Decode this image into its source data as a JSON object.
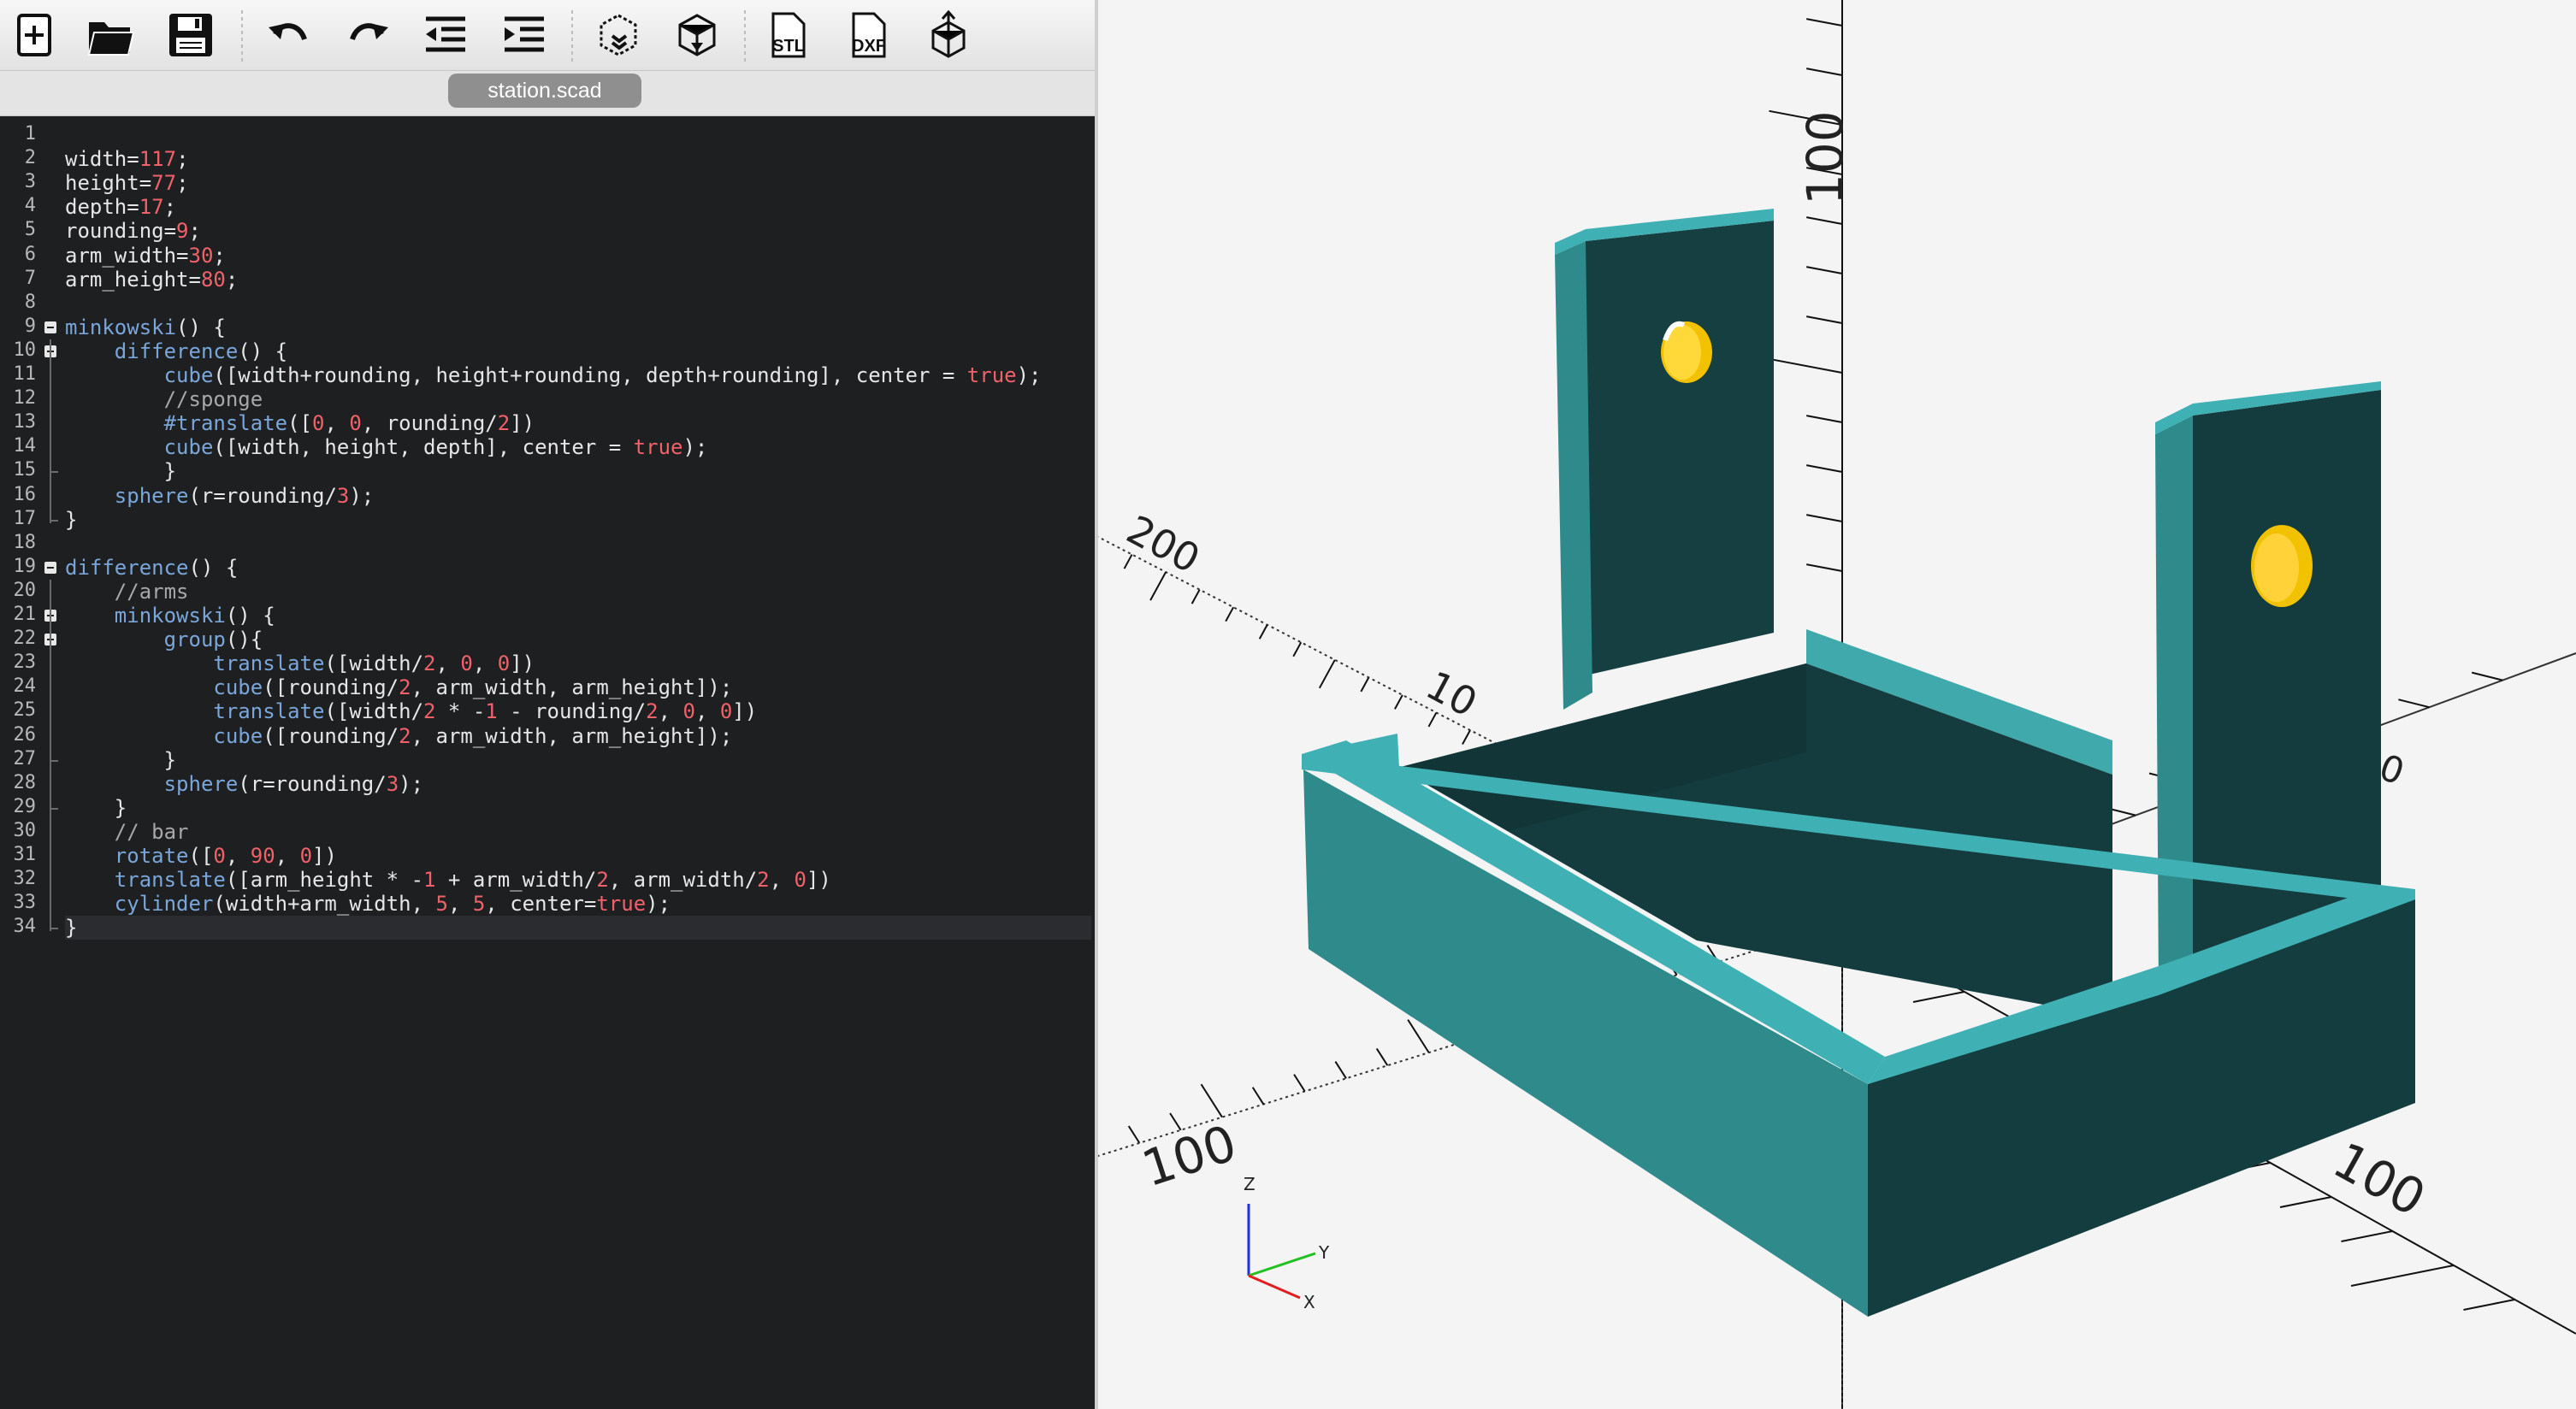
{
  "toolbar": {
    "buttons": [
      {
        "name": "new-file-icon"
      },
      {
        "name": "open-folder-icon"
      },
      {
        "name": "save-icon"
      },
      {
        "name": "undo-icon"
      },
      {
        "name": "redo-icon"
      },
      {
        "name": "unindent-icon"
      },
      {
        "name": "indent-icon"
      },
      {
        "name": "preview-icon"
      },
      {
        "name": "render-icon"
      },
      {
        "name": "export-stl-icon",
        "label": "STL"
      },
      {
        "name": "export-dxf-icon",
        "label": "DXF"
      },
      {
        "name": "send-to-print-icon"
      }
    ]
  },
  "editor": {
    "file_tab": "station.scad",
    "lines": [
      "",
      "width=117;",
      "height=77;",
      "depth=17;",
      "rounding=9;",
      "arm_width=30;",
      "arm_height=80;",
      "",
      "minkowski() {",
      "    difference() {",
      "        cube([width+rounding, height+rounding, depth+rounding], center = true);",
      "        //sponge",
      "        #translate([0, 0, rounding/2])",
      "        cube([width, height, depth], center = true);",
      "        }",
      "    sphere(r=rounding/3);",
      "}",
      "",
      "difference() {",
      "    //arms",
      "    minkowski() {",
      "        group(){",
      "            translate([width/2, 0, 0])",
      "            cube([rounding/2, arm_width, arm_height]);",
      "            translate([width/2 * -1 - rounding/2, 0, 0])",
      "            cube([rounding/2, arm_width, arm_height]);",
      "        }",
      "        sphere(r=rounding/3);",
      "    }",
      "    // bar",
      "    rotate([0, 90, 0])",
      "    translate([arm_height * -1 + arm_width/2, arm_width/2, 0])",
      "    cylinder(width+arm_width, 5, 5, center=true);",
      "}"
    ],
    "fold_markers": [
      9,
      10,
      19,
      21,
      22
    ]
  },
  "viewport": {
    "axis_labels": {
      "z_top": "100",
      "left_back": "200",
      "left_mid": "10",
      "left_front": "100",
      "right_front": "100",
      "right_back": "00"
    },
    "gizmo": {
      "x": "X",
      "y": "Y",
      "z": "Z"
    },
    "colors": {
      "model_face": "#2f8a8c",
      "model_top": "#3fb0b3",
      "model_dark": "#133e40",
      "hole": "#f2c200",
      "axis_x": "#e02020",
      "axis_y": "#20c020",
      "axis_z": "#2030e0"
    }
  }
}
